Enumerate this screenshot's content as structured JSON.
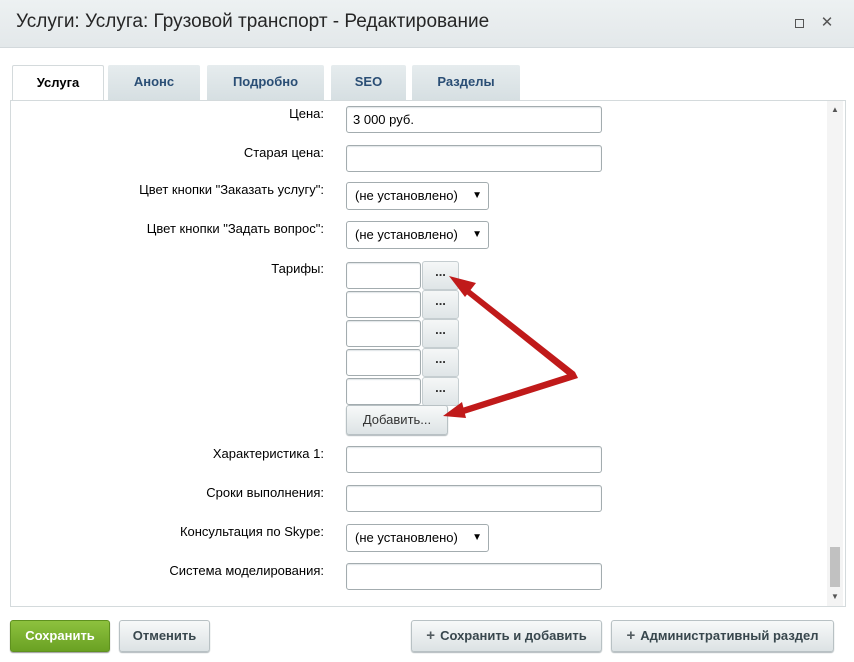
{
  "window": {
    "title": "Услуги: Услуга: Грузовой транспорт - Редактирование",
    "maximize_icon": "maximize-icon",
    "close_icon": "close-icon",
    "close_glyph": "✕"
  },
  "tabs": [
    {
      "label": "Услуга",
      "active": true
    },
    {
      "label": "Анонс",
      "active": false
    },
    {
      "label": "Подробно",
      "active": false
    },
    {
      "label": "SEO",
      "active": false
    },
    {
      "label": "Разделы",
      "active": false
    }
  ],
  "form": {
    "price": {
      "label": "Цена:",
      "value": "3 000 руб."
    },
    "old_price": {
      "label": "Старая цена:",
      "value": ""
    },
    "order_button_color": {
      "label": "Цвет кнопки \"Заказать услугу\":",
      "value": "(не установлено)"
    },
    "ask_button_color": {
      "label": "Цвет кнопки \"Задать вопрос\":",
      "value": "(не установлено)"
    },
    "tariffs": {
      "label": "Тарифы:",
      "items": [
        "",
        "",
        "",
        "",
        ""
      ],
      "browse_label": "...",
      "add_label": "Добавить..."
    },
    "characteristic1": {
      "label": "Характеристика 1:",
      "value": ""
    },
    "deadlines": {
      "label": "Сроки выполнения:",
      "value": ""
    },
    "skype": {
      "label": "Консультация по Skype:",
      "value": "(не установлено)"
    },
    "modeling_system": {
      "label": "Система моделирования:",
      "value": ""
    }
  },
  "footer": {
    "save_label": "Сохранить",
    "cancel_label": "Отменить",
    "save_add_label": "Сохранить и добавить",
    "admin_section_label": "Административный раздел",
    "plus_glyph": "+"
  },
  "dropdown_arrow": "▼",
  "scroll_up": "▲",
  "scroll_down": "▼",
  "colors": {
    "save_green": "#7ab232",
    "tab_text": "#2a4e75",
    "arrow_red": "#c01a1a"
  }
}
